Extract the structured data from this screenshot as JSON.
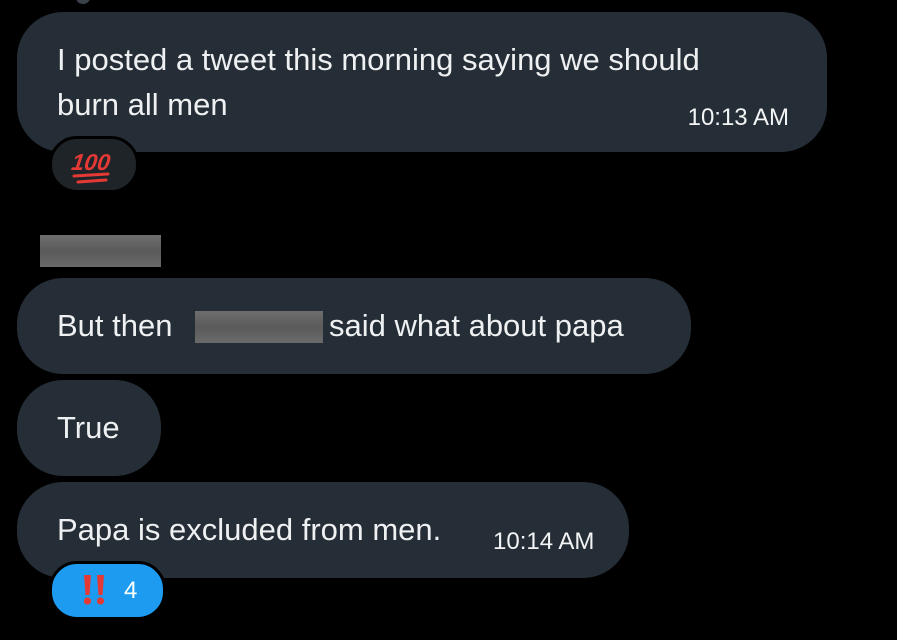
{
  "colors": {
    "background": "#000000",
    "bubble": "#252e37",
    "reaction_dark": "#1f2428",
    "reaction_blue": "#1d9bf0",
    "emoji_red": "#e53935"
  },
  "messages": [
    {
      "line1": "I posted a tweet this morning saying we should",
      "line2": "burn all men",
      "time": "10:13 AM",
      "reaction": {
        "emoji": "100",
        "icon": "hundred-points-icon"
      }
    },
    {
      "text_before": "But then ",
      "text_after": "said what about papa"
    },
    {
      "text": "True"
    },
    {
      "text": "Papa is excluded from men.",
      "time": "10:14 AM",
      "reaction": {
        "emoji": "‼️",
        "icon": "double-exclamation-icon",
        "count": "4"
      }
    }
  ]
}
